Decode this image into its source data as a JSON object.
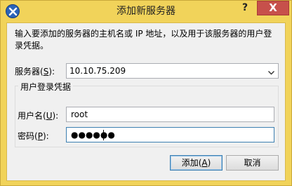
{
  "window": {
    "title": "添加新服务器",
    "help_label": "?",
    "close_label": "X"
  },
  "dialog": {
    "description": "输入要添加的服务器的主机名或 IP 地址，以及用于该服务器的用户登录凭据。",
    "server": {
      "label": "服务器",
      "hotkey": "S",
      "value": "10.10.75.209"
    },
    "credentials": {
      "group_title": "用户登录凭据",
      "username": {
        "label": "用户名",
        "hotkey": "U",
        "value": "root"
      },
      "password": {
        "label": "密码",
        "hotkey": "P",
        "value": "●●●●●●"
      }
    },
    "buttons": {
      "add": {
        "label": "添加",
        "hotkey": "A"
      },
      "cancel": {
        "label": "取消"
      }
    }
  }
}
